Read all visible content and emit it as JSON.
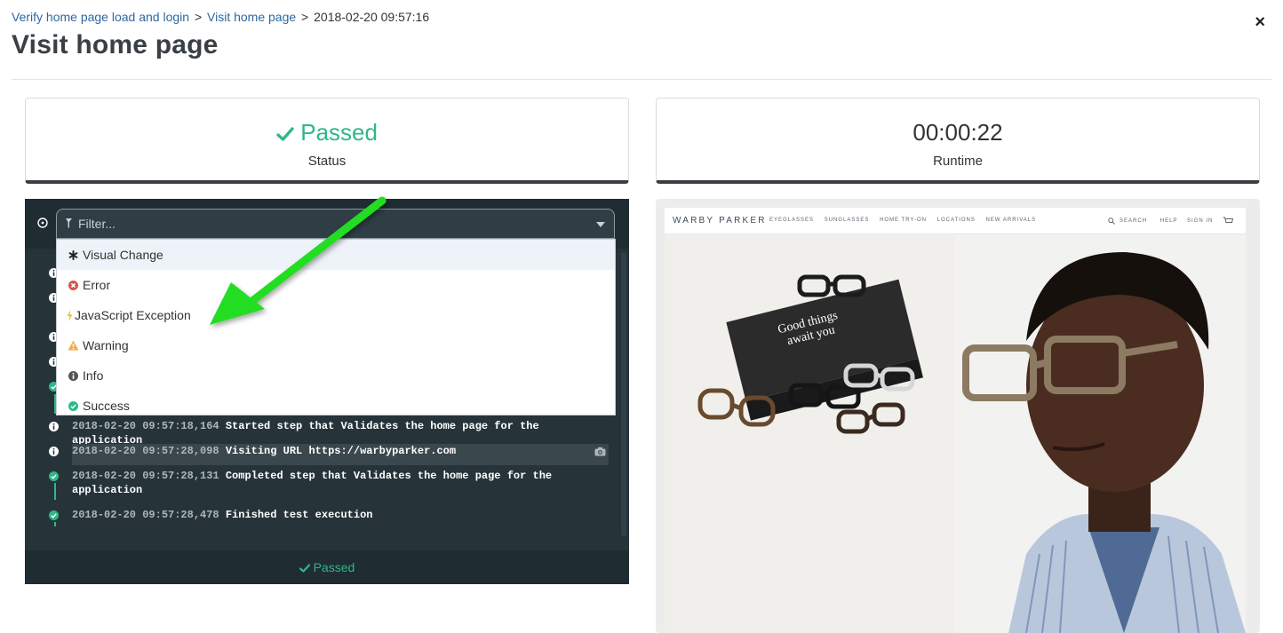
{
  "header": {
    "breadcrumb": [
      {
        "label": "Verify home page load and login"
      },
      {
        "label": "Visit home page"
      },
      {
        "label": "2018-02-20 09:57:16"
      }
    ],
    "separator": ">",
    "title": "Visit home page",
    "close_label": "×"
  },
  "cards": {
    "status": {
      "value": "Passed",
      "label": "Status",
      "color": "#2eb889"
    },
    "runtime": {
      "value": "00:00:22",
      "label": "Runtime"
    }
  },
  "log": {
    "filter_placeholder": "Filter...",
    "filter_options": [
      {
        "label": "Visual Change",
        "icon": "asterisk-icon"
      },
      {
        "label": "Error",
        "icon": "error-icon"
      },
      {
        "label": "JavaScript Exception",
        "icon": "bolt-icon"
      },
      {
        "label": "Warning",
        "icon": "warning-icon"
      },
      {
        "label": "Info",
        "icon": "info-icon"
      },
      {
        "label": "Success",
        "icon": "success-icon"
      }
    ],
    "entries": [
      {
        "timestamp": "2018-02-20 09:57:18,164",
        "message": "Started step that Validates the home page for the application",
        "type": "info"
      },
      {
        "timestamp": "2018-02-20 09:57:28,098",
        "message": "Visiting URL https://warbyparker.com",
        "type": "info"
      },
      {
        "timestamp": "2018-02-20 09:57:28,131",
        "message": "Completed step that Validates the home page for the application",
        "type": "success"
      },
      {
        "timestamp": "2018-02-20 09:57:28,478",
        "message": "Finished test execution",
        "type": "success"
      }
    ],
    "footer_status": "Passed"
  },
  "preview": {
    "brand": "WARBY PARKER",
    "nav": [
      "EYEGLASSES",
      "SUNGLASSES",
      "HOME TRY-ON",
      "LOCATIONS",
      "NEW ARRIVALS"
    ],
    "nav_right": [
      "SEARCH",
      "HELP",
      "SIGN IN"
    ],
    "box_text": "Good things await you"
  },
  "colors": {
    "success": "#2eb889",
    "error": "#d9534f",
    "warning": "#f0ad4e",
    "bolt": "#f0c330",
    "arrow": "#22dd22"
  }
}
